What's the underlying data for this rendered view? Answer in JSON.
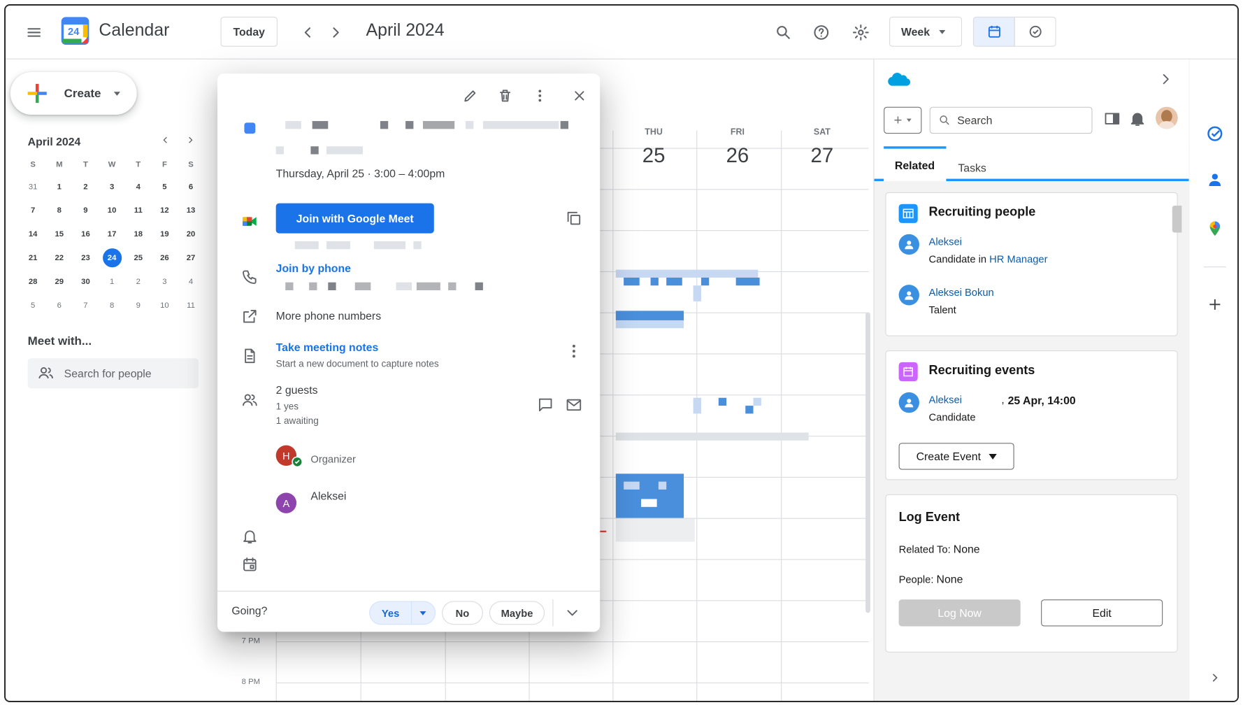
{
  "header": {
    "app_title": "Calendar",
    "logo_day": "24",
    "today_label": "Today",
    "month_title": "April 2024",
    "view_label": "Week"
  },
  "sidebar": {
    "create_label": "Create",
    "mini_month": "April 2024",
    "dow": [
      "S",
      "M",
      "T",
      "W",
      "T",
      "F",
      "S"
    ],
    "weeks": [
      [
        "31",
        "1",
        "2",
        "3",
        "4",
        "5",
        "6"
      ],
      [
        "7",
        "8",
        "9",
        "10",
        "11",
        "12",
        "13"
      ],
      [
        "14",
        "15",
        "16",
        "17",
        "18",
        "19",
        "20"
      ],
      [
        "21",
        "22",
        "23",
        "24",
        "25",
        "26",
        "27"
      ],
      [
        "28",
        "29",
        "30",
        "1",
        "2",
        "3",
        "4"
      ],
      [
        "5",
        "6",
        "7",
        "8",
        "9",
        "10",
        "11"
      ]
    ],
    "current_day": "24",
    "meet_title": "Meet with...",
    "search_people_placeholder": "Search for people"
  },
  "grid": {
    "days": [
      {
        "name": "THU",
        "date": "25"
      },
      {
        "name": "FRI",
        "date": "26"
      },
      {
        "name": "SAT",
        "date": "27"
      }
    ],
    "hours": [
      "7 PM",
      "8 PM"
    ]
  },
  "event": {
    "date_time": "Thursday, April 25  ·  3:00 – 4:00pm",
    "meet_button": "Join with Google Meet",
    "join_phone": "Join by phone",
    "more_phone": "More phone numbers",
    "notes_title": "Take meeting notes",
    "notes_sub": "Start a new document to capture notes",
    "guests_title": "2 guests",
    "guests_yes": "1 yes",
    "guests_awaiting": "1 awaiting",
    "organizer_initial": "H",
    "organizer_label": "Organizer",
    "guest_initial": "A",
    "guest_name": "Aleksei",
    "going_label": "Going?",
    "yes_label": "Yes",
    "no_label": "No",
    "maybe_label": "Maybe",
    "event_color": "#4285f4"
  },
  "salesforce": {
    "search_placeholder": "Search",
    "tab_related": "Related",
    "tab_tasks": "Tasks",
    "people_card": {
      "title": "Recruiting people",
      "p1_name": "Aleksei",
      "p1_role_prefix": "Candidate in ",
      "p1_role_link": "HR Manager",
      "p2_name": "Aleksei Bokun",
      "p2_role": "Talent"
    },
    "events_card": {
      "title": "Recruiting events",
      "e1_name": "Aleksei",
      "e1_sep": ",",
      "e1_time": "25 Apr, 14:00",
      "e1_role": "Candidate",
      "create_event_label": "Create Event"
    },
    "log_card": {
      "title": "Log Event",
      "related_label": "Related To:",
      "related_value": "None",
      "people_label": "People:",
      "people_value": "None",
      "log_now_label": "Log Now",
      "edit_label": "Edit"
    }
  }
}
